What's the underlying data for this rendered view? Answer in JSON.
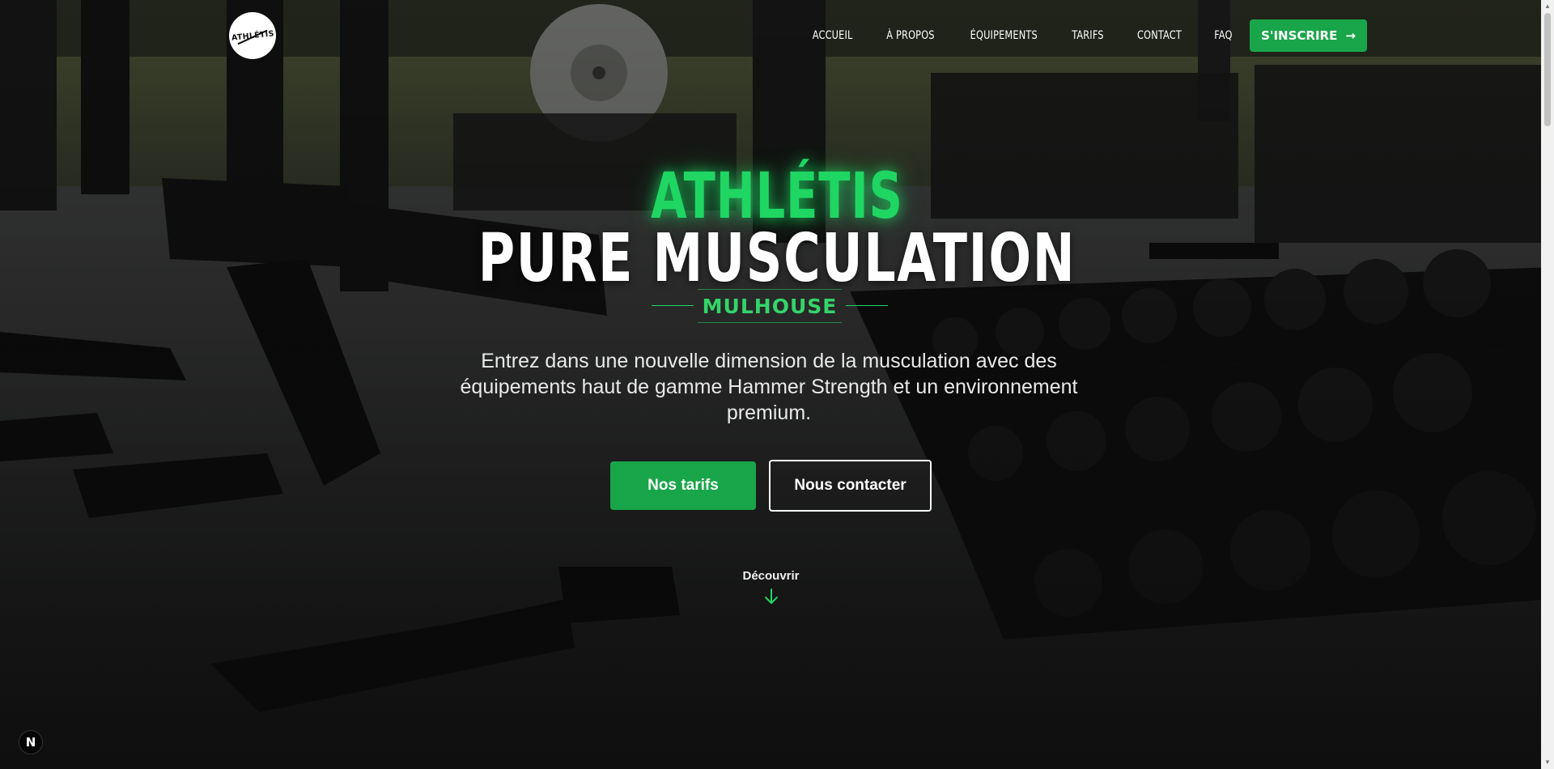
{
  "header": {
    "logo_text": "ATHLÉTIS",
    "nav": [
      {
        "label": "ACCUEIL"
      },
      {
        "label": "À PROPOS"
      },
      {
        "label": "ÉQUIPEMENTS"
      },
      {
        "label": "TARIFS"
      },
      {
        "label": "CONTACT"
      },
      {
        "label": "FAQ"
      }
    ],
    "cta_label": "S'INSCRIRE"
  },
  "hero": {
    "brand": "ATHLÉTIS",
    "title": "PURE MUSCULATION",
    "city": "MULHOUSE",
    "subtitle": "Entrez dans une nouvelle dimension de la musculation avec des équipements haut de gamme Hammer Strength et un environnement premium.",
    "primary_button": "Nos tarifs",
    "secondary_button": "Nous contacter",
    "discover_label": "Découvrir"
  },
  "badge": {
    "label": "N"
  },
  "colors": {
    "accent": "#19a549",
    "accent_glow": "#1fd663",
    "background": "#0f1010"
  }
}
